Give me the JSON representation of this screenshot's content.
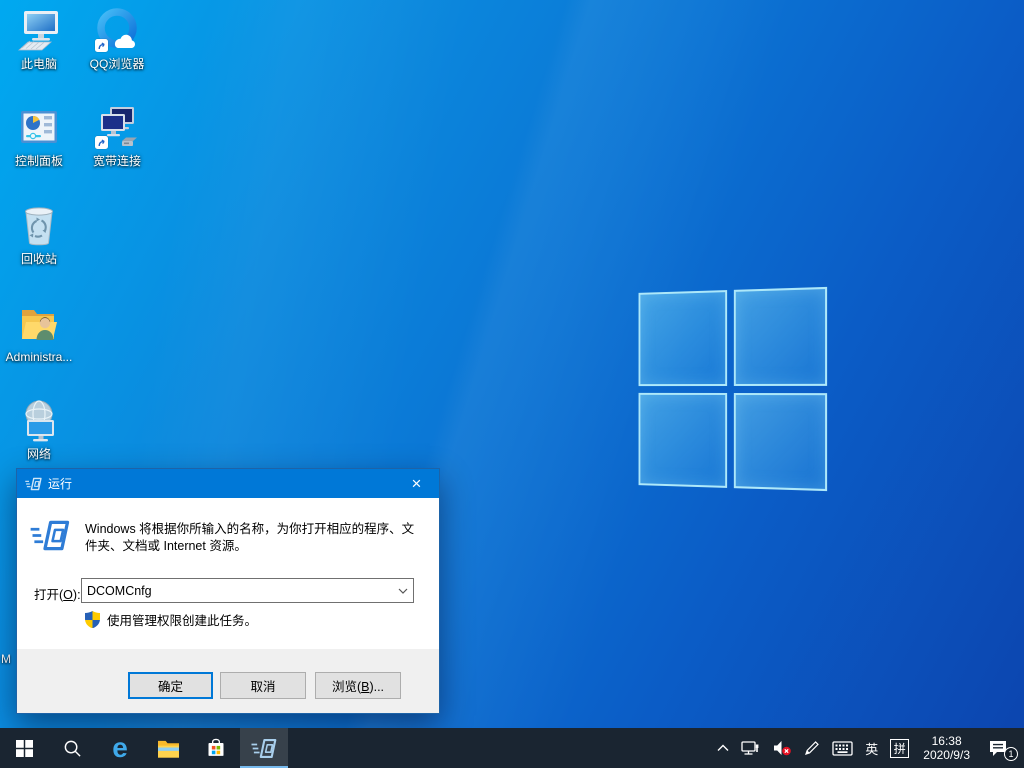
{
  "desktop": {
    "icons": [
      {
        "name": "this-pc",
        "label": "此电脑"
      },
      {
        "name": "qq-browser",
        "label": "QQ浏览器"
      },
      {
        "name": "control-panel",
        "label": "控制面板"
      },
      {
        "name": "broadband-connection",
        "label": "宽带连接"
      },
      {
        "name": "recycle-bin",
        "label": "回收站"
      },
      {
        "name": "administrator-folder",
        "label": "Administra..."
      },
      {
        "name": "network",
        "label": "网络"
      }
    ],
    "occluded_icon_label_fragment": "M"
  },
  "run_dialog": {
    "title": "运行",
    "description": "Windows 将根据你所输入的名称，为你打开相应的程序、文件夹、文档或 Internet 资源。",
    "open_label": {
      "prefix": "打开(",
      "mnemonic": "O",
      "suffix": "):"
    },
    "command_value": "DCOMCnfg",
    "admin_note": "使用管理权限创建此任务。",
    "buttons": {
      "ok": "确定",
      "cancel": "取消",
      "browse": {
        "prefix": "浏览(",
        "mnemonic": "B",
        "suffix": ")..."
      }
    },
    "close_glyph": "×"
  },
  "taskbar": {
    "items": [
      "start",
      "search",
      "edge",
      "file-explorer",
      "store",
      "run"
    ],
    "active_item": "run",
    "tray": {
      "ime_language": "英",
      "ime_mode": "拼",
      "time": "16:38",
      "date": "2020/9/3",
      "notification_badge": "1"
    }
  },
  "colors": {
    "accent": "#0078d7",
    "taskbar_bg": "#1a2531",
    "dialog_footer": "#f0f0f0",
    "wallpaper_top": "#00a9f0",
    "wallpaper_bottom": "#0c44ae"
  }
}
